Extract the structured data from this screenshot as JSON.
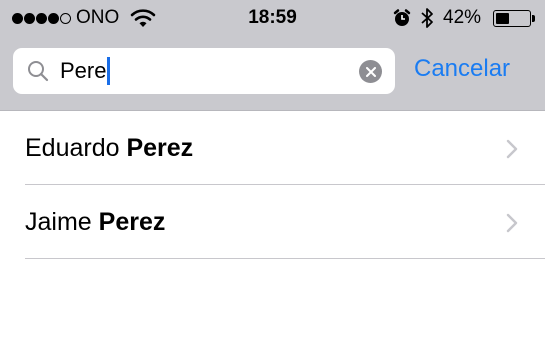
{
  "status_bar": {
    "carrier": "ONO",
    "signal_bars_filled": 4,
    "signal_bars_total": 5,
    "time": "18:59",
    "battery_percent": "42%",
    "battery_level": 0.42,
    "icons": [
      "wifi-icon",
      "alarm-clock-icon",
      "bluetooth-icon",
      "battery-icon"
    ]
  },
  "search": {
    "value": "Pere",
    "clear_icon": "clear-icon",
    "search_icon": "magnifier-icon"
  },
  "cancel_label": "Cancelar",
  "results": [
    {
      "first_name": "Eduardo ",
      "last_name": "Perez"
    },
    {
      "first_name": "Jaime ",
      "last_name": "Perez"
    }
  ],
  "colors": {
    "accent": "#1a7cf2",
    "header_background": "#c9c9ce",
    "separator": "#c8c7cc"
  }
}
